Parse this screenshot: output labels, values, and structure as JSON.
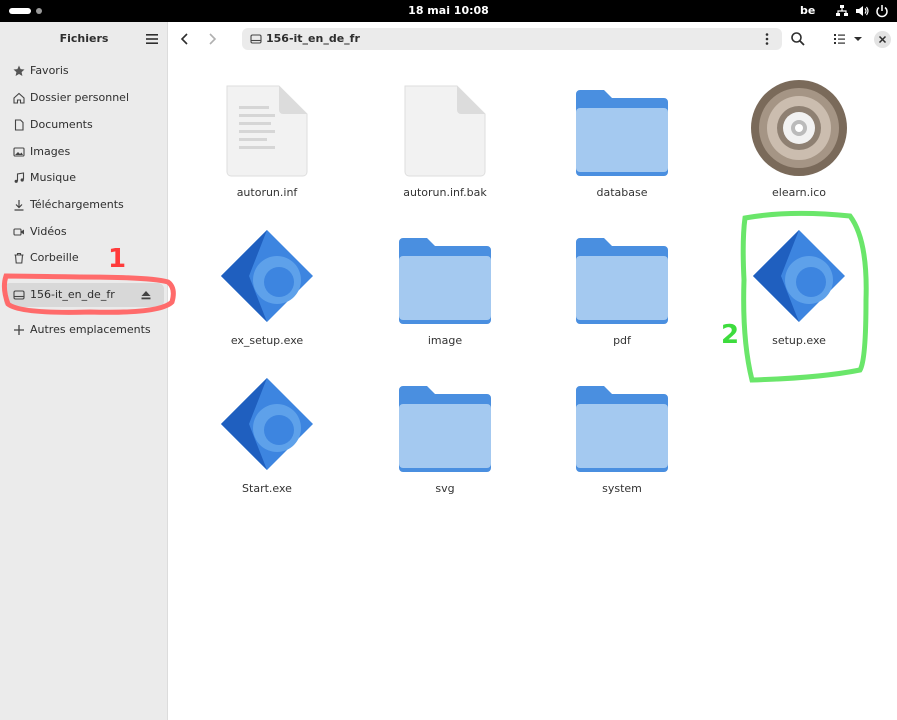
{
  "topbar": {
    "clock": "18 mai  10:08",
    "keyboard_layout": "be",
    "status_icons": [
      "network-icon",
      "volume-icon",
      "power-icon"
    ]
  },
  "sidebar": {
    "title": "Fichiers",
    "items": [
      {
        "label": "Favoris",
        "icon": "star-icon"
      },
      {
        "label": "Dossier personnel",
        "icon": "home-icon"
      },
      {
        "label": "Documents",
        "icon": "document-icon"
      },
      {
        "label": "Images",
        "icon": "image-icon"
      },
      {
        "label": "Musique",
        "icon": "music-icon"
      },
      {
        "label": "Téléchargements",
        "icon": "download-icon"
      },
      {
        "label": "Vidéos",
        "icon": "video-icon"
      },
      {
        "label": "Corbeille",
        "icon": "trash-icon"
      },
      {
        "label": "156-it_en_de_fr",
        "icon": "drive-icon",
        "active": true
      },
      {
        "label": "Autres emplacements",
        "icon": "plus-icon"
      }
    ]
  },
  "header": {
    "path": "156-it_en_de_fr"
  },
  "files": [
    {
      "name": "autorun.inf",
      "type": "text-file"
    },
    {
      "name": "autorun.inf.bak",
      "type": "blank-file"
    },
    {
      "name": "database",
      "type": "folder"
    },
    {
      "name": "elearn.ico",
      "type": "cd-image"
    },
    {
      "name": "ex_setup.exe",
      "type": "executable"
    },
    {
      "name": "image",
      "type": "folder"
    },
    {
      "name": "pdf",
      "type": "folder"
    },
    {
      "name": "setup.exe",
      "type": "executable"
    },
    {
      "name": "Start.exe",
      "type": "executable"
    },
    {
      "name": "svg",
      "type": "folder"
    },
    {
      "name": "system",
      "type": "folder"
    }
  ],
  "annotations": [
    {
      "label": "1",
      "color": "#ff4a4a"
    },
    {
      "label": "2",
      "color": "#3ddc3d"
    }
  ],
  "colors": {
    "folder_back": "#4a8fe0",
    "folder_front": "#a4c9f0",
    "exe_dark": "#1f5fbf",
    "exe_light": "#3d85e0",
    "sidebar_bg": "#ebebeb"
  }
}
